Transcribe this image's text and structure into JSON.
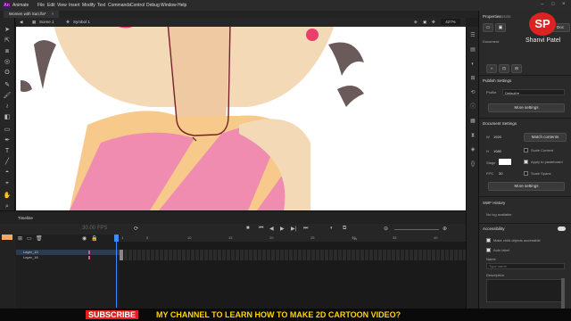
{
  "app": {
    "name": "Animate",
    "logo_text": "An"
  },
  "menus": [
    "File",
    "Edit",
    "View",
    "Insert",
    "Modify",
    "Text",
    "Commands",
    "Control",
    "Debug",
    "Window",
    "Help"
  ],
  "document_tab": {
    "title": "Women with Sari.fla*",
    "close": "×"
  },
  "breadcrumb": {
    "scene": "Scene 1",
    "symbol": "Symbol 1",
    "zoom": "427%"
  },
  "right_panel": {
    "tabs": [
      "Properties",
      "Assets"
    ],
    "doc_button": "Doc",
    "document_label": "Document",
    "watermark_name": "Shanvi Patel",
    "publish_settings": {
      "title": "Publish Settings",
      "profile_label": "Profile",
      "profile_value": "Default",
      "more_button": "More settings"
    },
    "document_settings": {
      "title": "Document Settings",
      "width_label": "W",
      "width_value": "1920",
      "height_label": "H",
      "height_value": "1080",
      "match_contents": "Match contents",
      "scale_content": "Scale Content",
      "stage_label": "Stage",
      "apply_to_pasteboard": "Apply to pasteboard",
      "fps_label": "FPS",
      "fps_value": "30",
      "scale_spans": "Scale Spans",
      "more_button": "More settings"
    },
    "swf_history": {
      "title": "SWF History",
      "empty": "No log available"
    },
    "accessibility": {
      "title": "Accessibility",
      "make_child_objects": "Make child objects accessible",
      "auto_label": "Auto label",
      "name_label": "Name",
      "name_placeholder": "Type name",
      "description_label": "Description"
    }
  },
  "timeline": {
    "title": "Timeline",
    "fps": "30.00",
    "fps_unit": "FPS",
    "frame_numbers": [
      "1",
      "5",
      "10",
      "15",
      "20",
      "25",
      "30",
      "35",
      "40",
      "45",
      "50",
      "55"
    ],
    "playhead_label": "1s",
    "layers": [
      {
        "name": "Layer_10",
        "selected": true,
        "color": "#e84c9c"
      },
      {
        "name": "Layer_16",
        "selected": false,
        "color": "#e84c9c"
      }
    ]
  },
  "banner": {
    "subscribe": "SUBSCRIBE",
    "message": "MY CHANNEL TO LEARN HOW TO MAKE 2D CARTOON VIDEO?"
  },
  "colors": {
    "skin": "#f4d9b6",
    "sari_pink": "#f08cb0",
    "sari_orange": "#f7c98a",
    "hair": "#6b5a5a",
    "bindi": "#e8406a",
    "outline": "#7a1f2e",
    "accent": "#e84c9c"
  }
}
